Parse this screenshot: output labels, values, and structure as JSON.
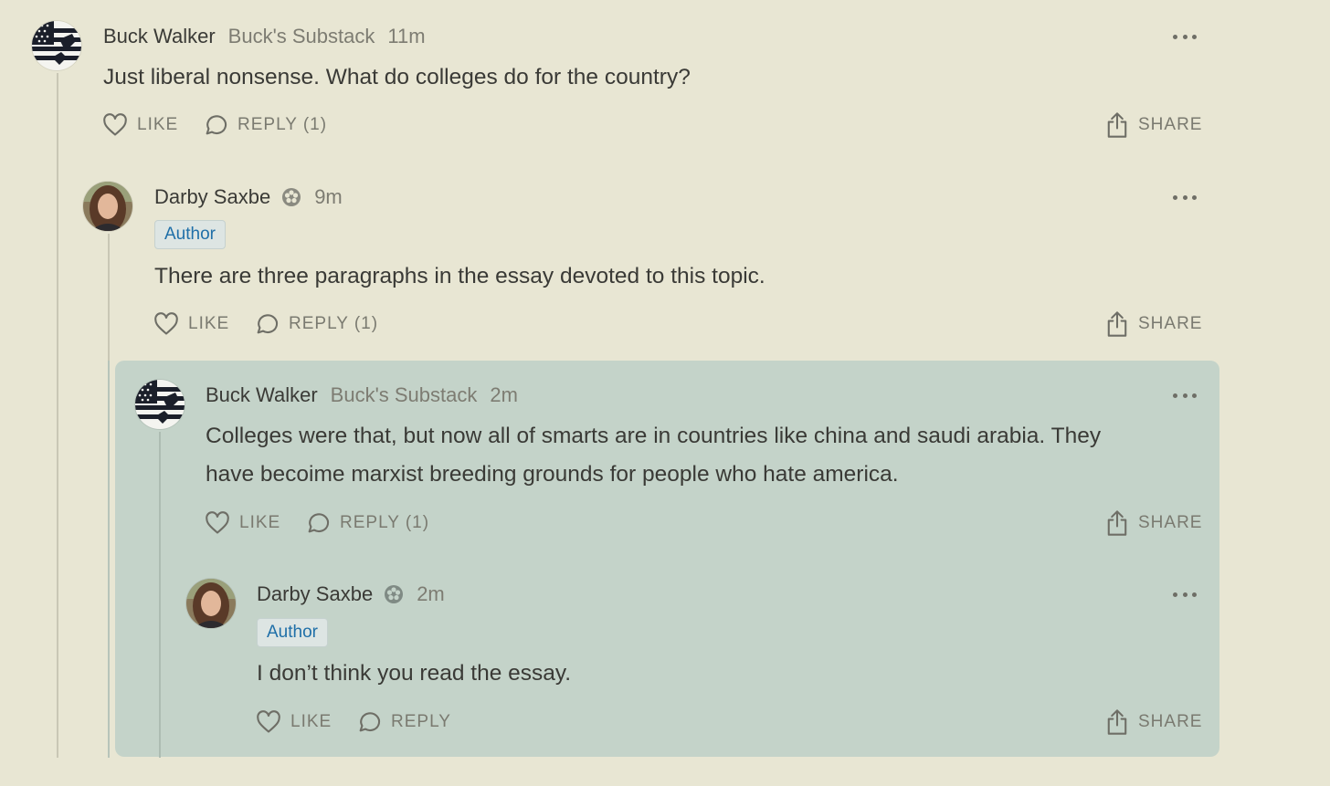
{
  "comments": [
    {
      "author": "Buck Walker",
      "publication": "Buck's Substack",
      "time": "11m",
      "text": [
        "Just liberal nonsense. What do colleges do for the country?"
      ],
      "like": "LIKE",
      "reply": "REPLY (1)",
      "share": "SHARE"
    },
    {
      "author": "Darby Saxbe",
      "time": "9m",
      "badge": "Author",
      "text": [
        "There are three paragraphs in the essay devoted to this topic."
      ],
      "like": "LIKE",
      "reply": "REPLY (1)",
      "share": "SHARE"
    },
    {
      "author": "Buck Walker",
      "publication": "Buck's Substack",
      "time": "2m",
      "text": [
        "Colleges were that, but now all of smarts are in countries like china and saudi arabia. They",
        "have becoime marxist breeding grounds for people who hate america."
      ],
      "like": "LIKE",
      "reply": "REPLY (1)",
      "share": "SHARE"
    },
    {
      "author": "Darby Saxbe",
      "time": "2m",
      "badge": "Author",
      "text": [
        "I don’t think you read the essay."
      ],
      "like": "LIKE",
      "reply": "REPLY",
      "share": "SHARE"
    }
  ],
  "colors": {
    "background": "#e8e6d3",
    "highlight": "#c4d3c9",
    "author_badge_text": "#1f6fa8"
  },
  "icons": {
    "like": "heart-icon",
    "reply": "speech-bubble-icon",
    "share": "share-upload-icon",
    "more": "more-dots-icon",
    "subscriber": "flower-badge-icon"
  }
}
